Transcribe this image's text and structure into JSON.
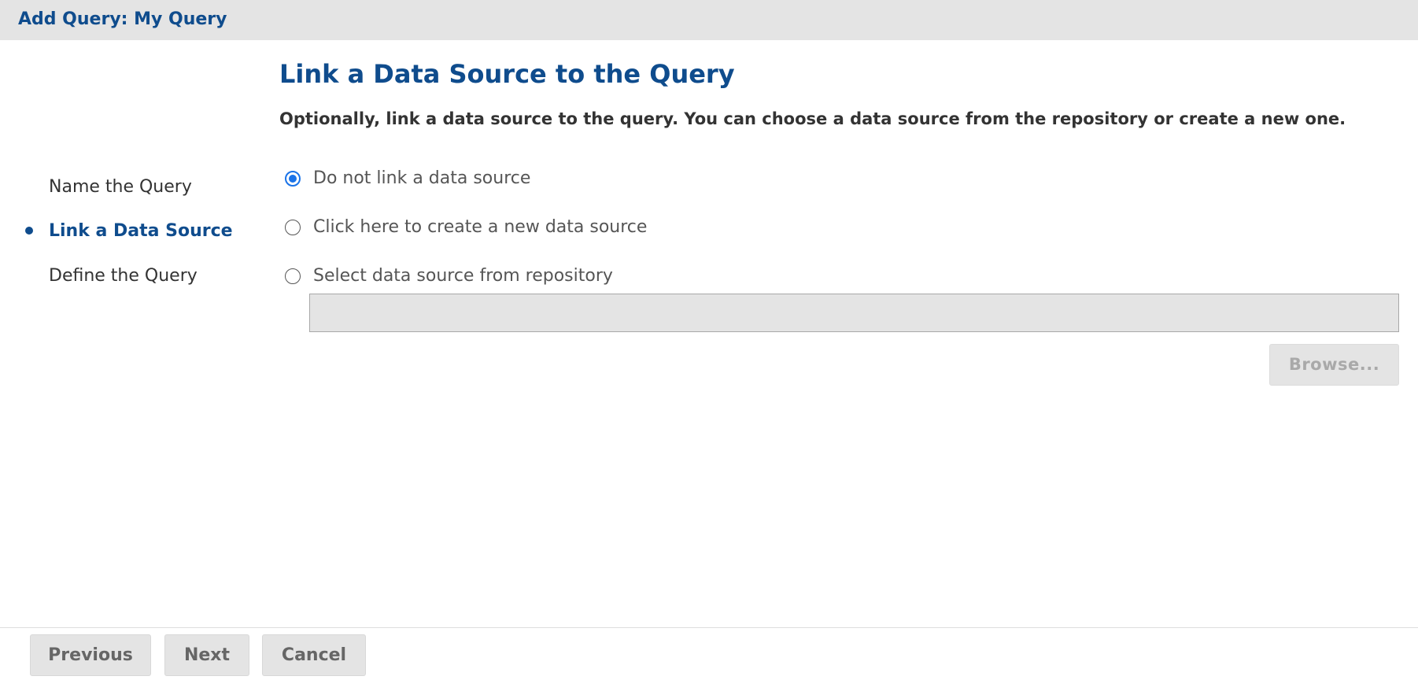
{
  "window": {
    "title": "Add Query: My Query"
  },
  "steps": [
    {
      "label": "Name the Query",
      "active": false
    },
    {
      "label": "Link a Data Source",
      "active": true
    },
    {
      "label": "Define the Query",
      "active": false
    }
  ],
  "main": {
    "heading": "Link a Data Source to the Query",
    "description": "Optionally, link a data source to the query. You can choose a data source from the repository or create a new one.",
    "options": [
      {
        "label": "Do not link a data source",
        "checked": true
      },
      {
        "label": "Click here to create a new data source",
        "checked": false
      },
      {
        "label": "Select data source from repository",
        "checked": false
      }
    ],
    "repository_path": {
      "value": "",
      "disabled": true
    },
    "browse_label": "Browse..."
  },
  "footer": {
    "previous_label": "Previous",
    "next_label": "Next",
    "cancel_label": "Cancel"
  },
  "colors": {
    "accent": "#0f4c8d",
    "radio_selected": "#1a73e8",
    "titlebar_bg": "#e4e4e4",
    "button_bg": "#e4e4e4",
    "disabled_text": "#a9a9a9"
  }
}
